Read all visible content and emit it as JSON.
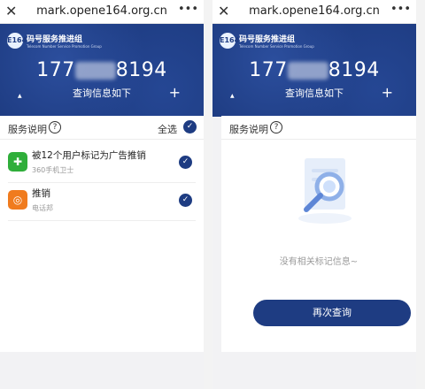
{
  "left": {
    "address_bar": {
      "url": "mark.opene164.org.cn",
      "close_icon": "close-icon",
      "more_icon": "more-icon"
    },
    "brand": {
      "logo_text": "E164",
      "name": "码号服务推进组",
      "tagline": "Telecom Number Service Promotion Group"
    },
    "phone": {
      "prefix": "177",
      "suffix": "8194"
    },
    "subtitle": "查询信息如下",
    "card": {
      "title": "服务说明",
      "select_all": "全选",
      "items": [
        {
          "name": "被12个用户标记为广告推销",
          "source": "360手机卫士",
          "icon": "shield-plus-icon",
          "color": "#2fae3a"
        },
        {
          "name": "推销",
          "source": "电话邦",
          "icon": "phone-ring-icon",
          "color": "#f07b1e"
        }
      ]
    }
  },
  "right": {
    "address_bar": {
      "url": "mark.opene164.org.cn",
      "close_icon": "close-icon",
      "more_icon": "more-icon"
    },
    "brand": {
      "logo_text": "E164",
      "name": "码号服务推进组",
      "tagline": "Telecom Number Service Promotion Group"
    },
    "phone": {
      "prefix": "177",
      "suffix": "8194"
    },
    "subtitle": "查询信息如下",
    "card": {
      "title": "服务说明",
      "empty_text": "没有相关标记信息~",
      "retry_label": "再次查询"
    }
  },
  "colors": {
    "navy": "#1e3c82",
    "green": "#2fae3a",
    "orange": "#f07b1e"
  }
}
